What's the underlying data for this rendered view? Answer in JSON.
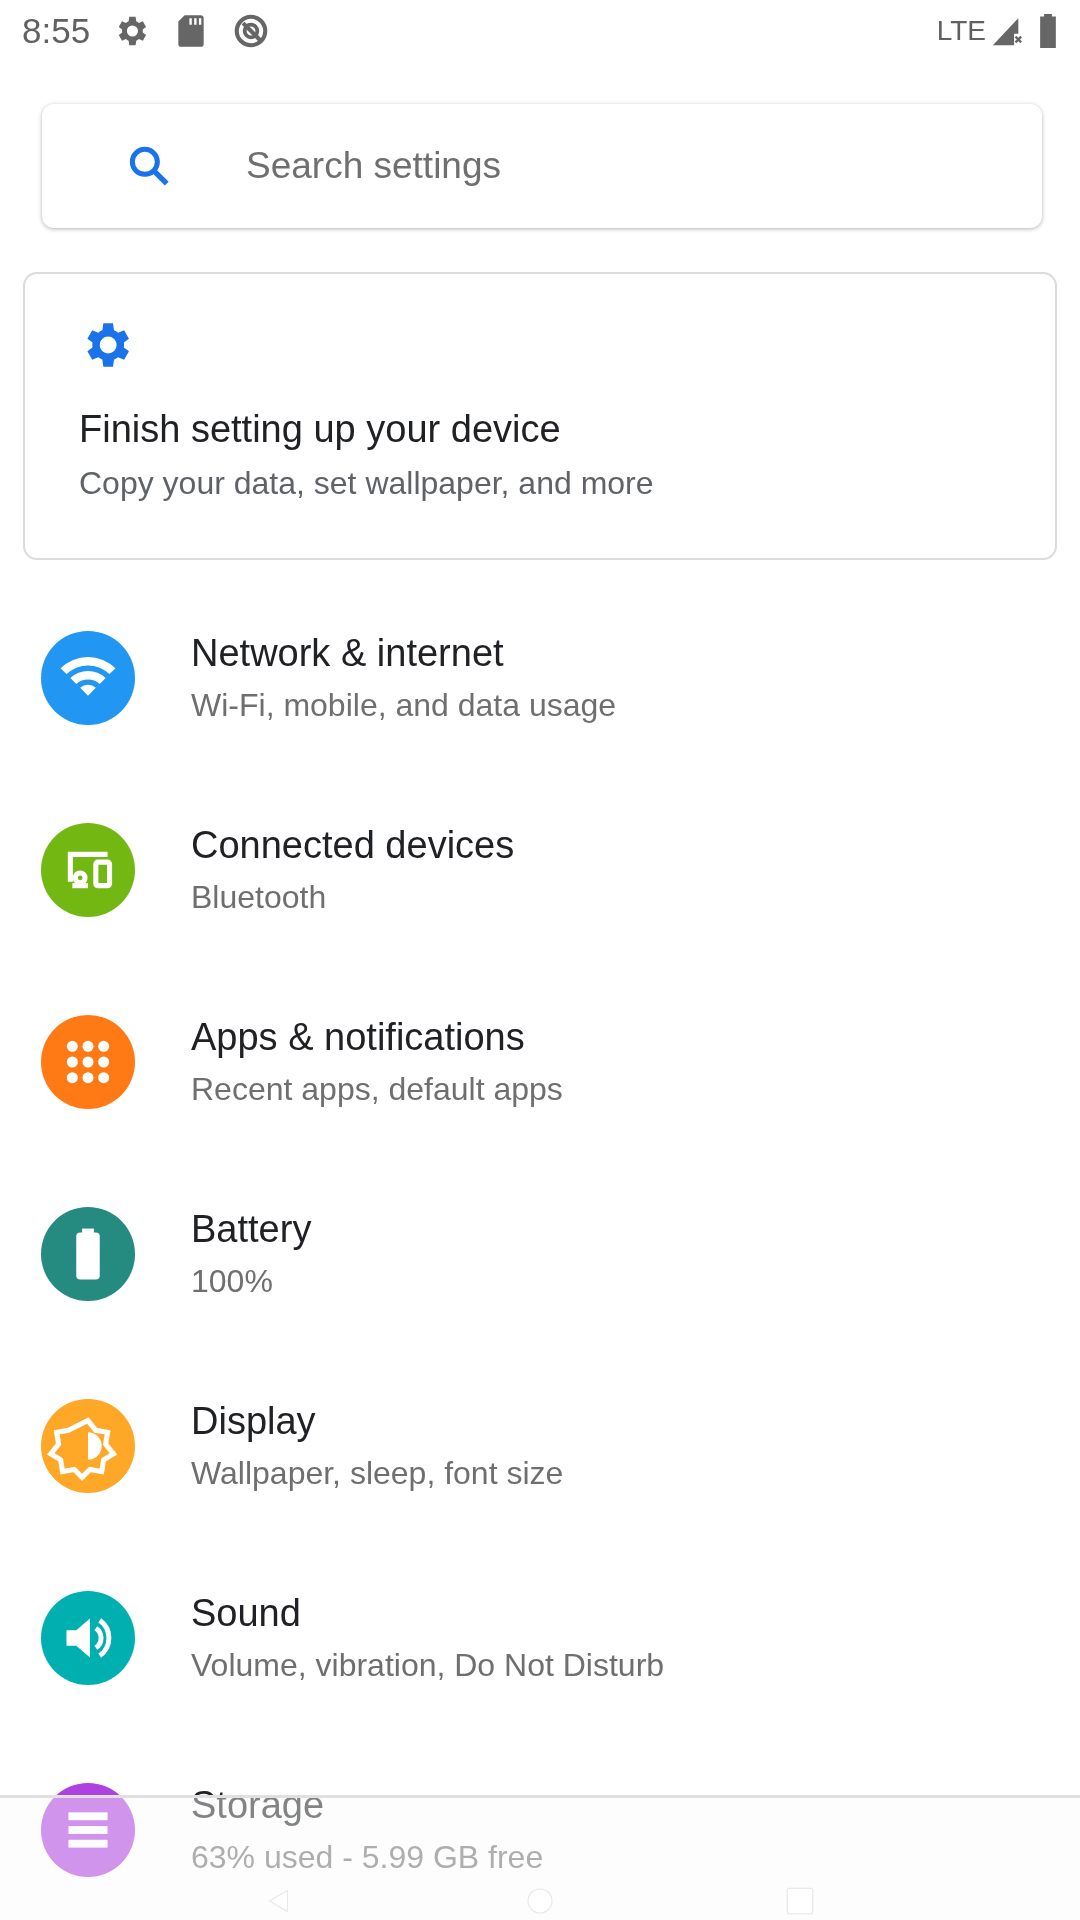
{
  "status_bar": {
    "time": "8:55",
    "network": "LTE"
  },
  "search": {
    "placeholder": "Search settings"
  },
  "setup_card": {
    "title": "Finish setting up your device",
    "subtitle": "Copy your data, set wallpaper, and more"
  },
  "items": [
    {
      "kind": "wifi",
      "title": "Network & internet",
      "subtitle": "Wi-Fi, mobile, and data usage",
      "color": "#2196f3"
    },
    {
      "kind": "devices",
      "title": "Connected devices",
      "subtitle": "Bluetooth",
      "color": "#73b812"
    },
    {
      "kind": "apps",
      "title": "Apps & notifications",
      "subtitle": "Recent apps, default apps",
      "color": "#ff7a14"
    },
    {
      "kind": "battery",
      "title": "Battery",
      "subtitle": "100%",
      "color": "#258a80"
    },
    {
      "kind": "display",
      "title": "Display",
      "subtitle": "Wallpaper, sleep, font size",
      "color": "#ffa726"
    },
    {
      "kind": "sound",
      "title": "Sound",
      "subtitle": "Volume, vibration, Do Not Disturb",
      "color": "#00b0b0"
    },
    {
      "kind": "storage",
      "title": "Storage",
      "subtitle": "63% used - 5.99 GB free",
      "color": "#b040e0"
    }
  ]
}
